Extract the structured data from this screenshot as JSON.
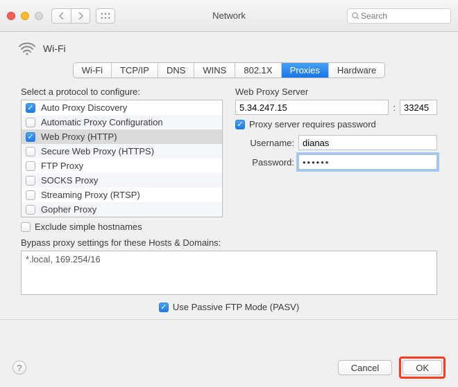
{
  "window": {
    "title": "Network",
    "searchPlaceholder": "Search"
  },
  "interface": {
    "name": "Wi-Fi"
  },
  "tabs": [
    "Wi-Fi",
    "TCP/IP",
    "DNS",
    "WINS",
    "802.1X",
    "Proxies",
    "Hardware"
  ],
  "tabsSelected": "Proxies",
  "protoLabel": "Select a protocol to configure:",
  "protocols": [
    {
      "label": "Auto Proxy Discovery",
      "checked": true,
      "selected": false
    },
    {
      "label": "Automatic Proxy Configuration",
      "checked": false,
      "selected": false
    },
    {
      "label": "Web Proxy (HTTP)",
      "checked": true,
      "selected": true
    },
    {
      "label": "Secure Web Proxy (HTTPS)",
      "checked": false,
      "selected": false
    },
    {
      "label": "FTP Proxy",
      "checked": false,
      "selected": false
    },
    {
      "label": "SOCKS Proxy",
      "checked": false,
      "selected": false
    },
    {
      "label": "Streaming Proxy (RTSP)",
      "checked": false,
      "selected": false
    },
    {
      "label": "Gopher Proxy",
      "checked": false,
      "selected": false
    }
  ],
  "excludeSimple": {
    "label": "Exclude simple hostnames",
    "checked": false
  },
  "server": {
    "title": "Web Proxy Server",
    "host": "5.34.247.15",
    "portSep": ":",
    "port": "33245",
    "requires": {
      "label": "Proxy server requires password",
      "checked": true
    },
    "usernameLabel": "Username:",
    "username": "dianas",
    "passwordLabel": "Password:",
    "passwordMasked": "••••••"
  },
  "bypass": {
    "label": "Bypass proxy settings for these Hosts & Domains:",
    "value": "*.local, 169.254/16"
  },
  "pasv": {
    "label": "Use Passive FTP Mode (PASV)",
    "checked": true
  },
  "buttons": {
    "cancel": "Cancel",
    "ok": "OK",
    "help": "?"
  }
}
